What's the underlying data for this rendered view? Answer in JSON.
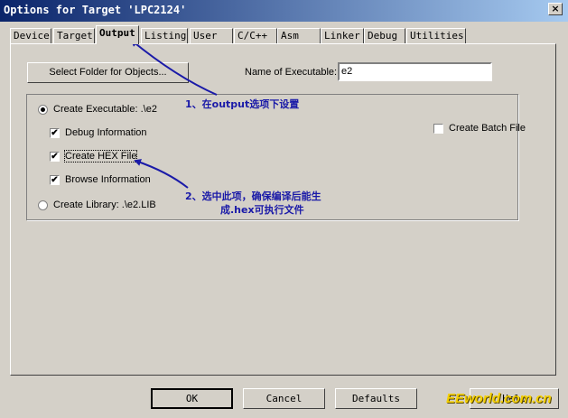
{
  "window": {
    "title": "Options for Target 'LPC2124'",
    "close_glyph": "×"
  },
  "tabs": [
    "Device",
    "Target",
    "Output",
    "Listing",
    "User",
    "C/C++",
    "Asm",
    "Linker",
    "Debug",
    "Utilities"
  ],
  "output": {
    "select_folder_label": "Select Folder for Objects...",
    "name_exec_label": "Name of Executable:",
    "name_exec_value": "e2",
    "create_exec_label": "Create Executable:  .\\e2",
    "debug_info_label": "Debug Information",
    "create_hex_label": "Create HEX File",
    "browse_info_label": "Browse Information",
    "create_lib_label": "Create Library:  .\\e2.LIB",
    "batch_label": "Create Batch File",
    "debug_info_checked": true,
    "create_hex_checked": true,
    "browse_info_checked": true,
    "batch_checked": false,
    "create_exec_selected": true
  },
  "annotations": {
    "note1": "1、在output选项下设置",
    "note2_line1": "2、选中此项，确保编译后能生",
    "note2_line2": "成.hex可执行文件",
    "color": "#1a1aa8"
  },
  "footer": {
    "ok": "OK",
    "cancel": "Cancel",
    "defaults": "Defaults",
    "help": "Help"
  },
  "watermark": "EEworld.com.cn",
  "check_glyph": "✔"
}
